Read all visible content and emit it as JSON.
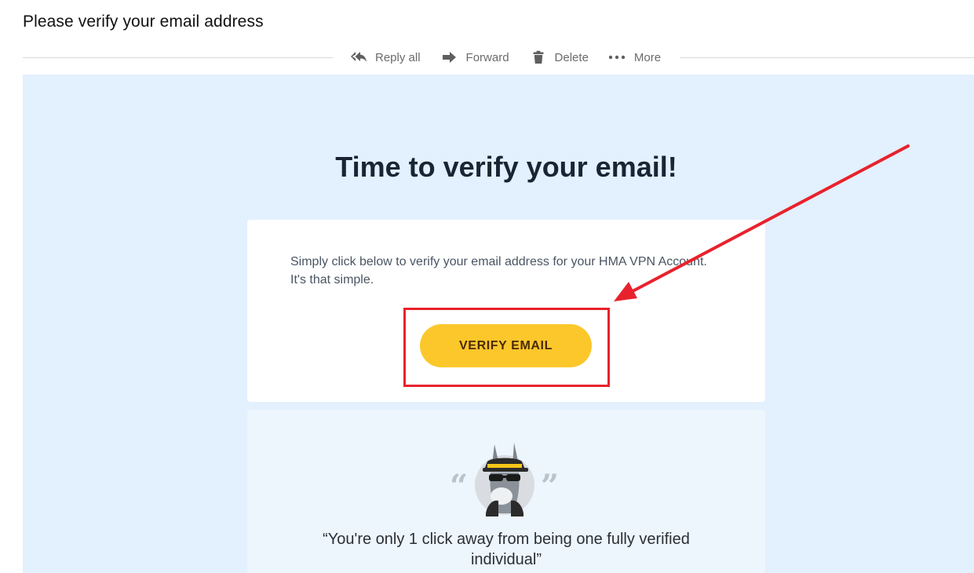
{
  "email": {
    "subject": "Please verify your email address"
  },
  "toolbar": {
    "reply_all": {
      "label": "Reply all",
      "icon": "reply-all-icon"
    },
    "forward": {
      "label": "Forward",
      "icon": "forward-arrow-icon"
    },
    "delete": {
      "label": "Delete",
      "icon": "trash-icon"
    },
    "more": {
      "label": "More",
      "icon": "ellipsis-icon"
    }
  },
  "content": {
    "headline": "Time to verify your email!",
    "body_line1": "Simply click below to verify your email address for your HMA VPN Account.",
    "body_line2": "It's that simple.",
    "button_label": "VERIFY EMAIL",
    "quote_line1": "“You're only 1 click away from being one fully verified",
    "quote_line2": "individual”",
    "quote_open": "“",
    "quote_close": "”"
  },
  "colors": {
    "mail_background": "#e3f0fd",
    "button": "#fcc72b",
    "button_text": "#4a2a05",
    "annotation": "#e8222d"
  }
}
